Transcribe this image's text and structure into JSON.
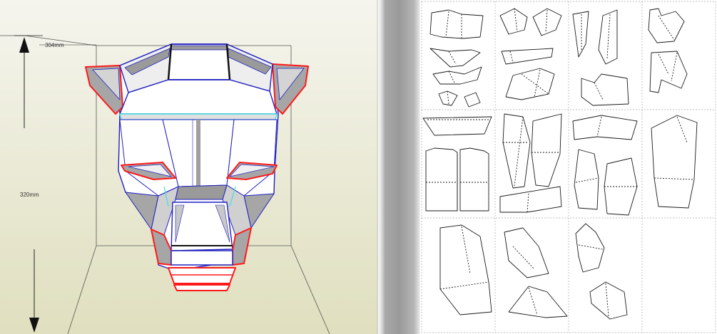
{
  "viewer": {
    "dimension_width": "304mm",
    "dimension_height": "320mm"
  },
  "colors": {
    "background_light": "#f2f2e8",
    "background_dark": "#e3e2c4",
    "mountain_fold": "#ff1a1a",
    "valley_fold": "#2020c0",
    "glue_edge": "#40e0e0",
    "face_fill": "#ffffff",
    "shadow_fill": "#a6a6a6"
  },
  "sheet": {
    "grid": "4x3",
    "page_count": 12,
    "blank_page": "last"
  }
}
